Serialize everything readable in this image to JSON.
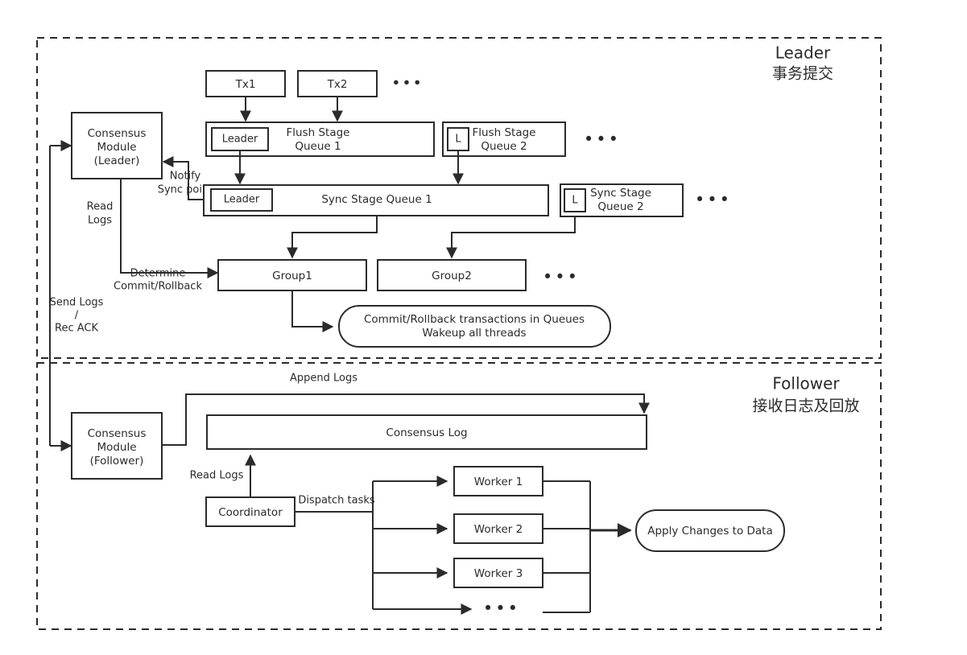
{
  "sections": {
    "leader": {
      "title": "Leader",
      "subtitle": "事务提交"
    },
    "follower": {
      "title": "Follower",
      "subtitle": "接收日志及回放"
    }
  },
  "leader": {
    "consensus_module": {
      "line1": "Consensus",
      "line2": "Module",
      "line3": "(Leader)"
    },
    "transactions": [
      {
        "label": "Tx1"
      },
      {
        "label": "Tx2"
      }
    ],
    "tx_ellipsis": "•••",
    "flush_queues": [
      {
        "badge": "Leader",
        "line1": "Flush Stage",
        "line2": "Queue 1"
      },
      {
        "badge": "L",
        "line1": "Flush Stage",
        "line2": "Queue 2"
      }
    ],
    "flush_ellipsis": "•••",
    "sync_queues": [
      {
        "badge": "Leader",
        "line1": "Sync Stage Queue 1",
        "line2": ""
      },
      {
        "badge": "L",
        "line1": "Sync Stage",
        "line2": "Queue 2"
      }
    ],
    "sync_ellipsis": "•••",
    "groups": [
      {
        "label": "Group1"
      },
      {
        "label": "Group2"
      }
    ],
    "group_ellipsis": "•••",
    "commit_action": {
      "line1": "Commit/Rollback transactions in Queues",
      "line2": "Wakeup all threads"
    },
    "labels": {
      "notify_line1": "Notify",
      "notify_line2": "Sync point",
      "read_logs_line1": "Read",
      "read_logs_line2": "Logs",
      "determine_line1": "Determine",
      "determine_line2": "Commit/Rollback",
      "send_logs_line1": "Send Logs",
      "send_logs_line2": "/",
      "send_logs_line3": "Rec ACK"
    }
  },
  "follower": {
    "consensus_module": {
      "line1": "Consensus",
      "line2": "Module",
      "line3": "(Follower)"
    },
    "consensus_log": {
      "label": "Consensus Log"
    },
    "coordinator": {
      "label": "Coordinator"
    },
    "workers": [
      {
        "label": "Worker  1"
      },
      {
        "label": "Worker 2"
      },
      {
        "label": "Worker 3"
      }
    ],
    "worker_ellipsis": "•••",
    "apply": {
      "label": "Apply Changes to Data"
    },
    "labels": {
      "append_logs": "Append Logs",
      "read_logs": "Read Logs",
      "dispatch_tasks": "Dispatch tasks"
    }
  },
  "colors": {
    "stroke": "#2b2b2b",
    "fill": "#ffffff",
    "background": "#ffffff"
  }
}
